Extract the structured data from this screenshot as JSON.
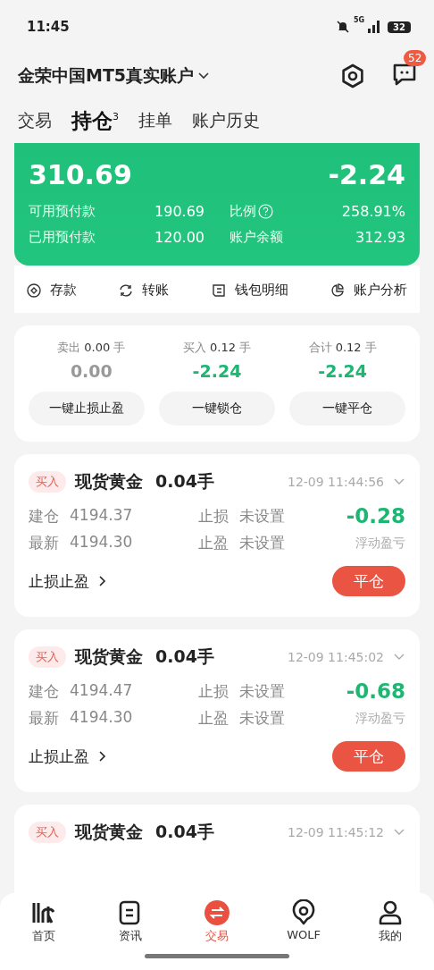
{
  "status_bar": {
    "time": "11:45",
    "network": "5G",
    "battery": "32"
  },
  "header": {
    "account": "金荣中国MT5真实账户",
    "badge": "52"
  },
  "tabs": [
    {
      "label": "交易",
      "selected": false
    },
    {
      "label": "持仓",
      "selected": true,
      "sup": "3"
    },
    {
      "label": "挂单",
      "selected": false
    },
    {
      "label": "账户历史",
      "selected": false
    }
  ],
  "equity": {
    "value": "310.69",
    "pnl": "-2.24",
    "stats": [
      {
        "label": "可用预付款",
        "value": "190.69"
      },
      {
        "label": "比例",
        "value": "258.91%",
        "help": true
      },
      {
        "label": "已用预付款",
        "value": "120.00"
      },
      {
        "label": "账户余额",
        "value": "312.93"
      }
    ]
  },
  "actions": [
    {
      "label": "存款",
      "kind": "deposit"
    },
    {
      "label": "转账",
      "kind": "transfer"
    },
    {
      "label": "钱包明细",
      "kind": "wallet"
    },
    {
      "label": "账户分析",
      "kind": "analysis"
    }
  ],
  "summary": {
    "columns": [
      {
        "label": "卖出",
        "lots": "0.00",
        "unit": "手",
        "pnl": "0.00",
        "loss": false
      },
      {
        "label": "买入",
        "lots": "0.12",
        "unit": "手",
        "pnl": "-2.24",
        "loss": true
      },
      {
        "label": "合计",
        "lots": "0.12",
        "unit": "手",
        "pnl": "-2.24",
        "loss": true
      }
    ],
    "buttons": [
      "一键止损止盈",
      "一键锁仓",
      "一键平仓"
    ]
  },
  "positions": [
    {
      "side": "买入",
      "symbol": "现货黄金",
      "lots": "0.04手",
      "time": "12-09 11:44:56",
      "open_label": "建仓",
      "open": "4194.37",
      "last_label": "最新",
      "last": "4194.30",
      "sl_label": "止损",
      "sl": "未设置",
      "tp_label": "止盈",
      "tp": "未设置",
      "pnl": "-0.28",
      "pnl_label": "浮动盈亏",
      "sltp_link": "止损止盈",
      "close": "平仓"
    },
    {
      "side": "买入",
      "symbol": "现货黄金",
      "lots": "0.04手",
      "time": "12-09 11:45:02",
      "open_label": "建仓",
      "open": "4194.47",
      "last_label": "最新",
      "last": "4194.30",
      "sl_label": "止损",
      "sl": "未设置",
      "tp_label": "止盈",
      "tp": "未设置",
      "pnl": "-0.68",
      "pnl_label": "浮动盈亏",
      "sltp_link": "止损止盈",
      "close": "平仓"
    },
    {
      "side": "买入",
      "symbol": "现货黄金",
      "lots": "0.04手",
      "time": "12-09 11:45:12"
    }
  ],
  "nav": [
    {
      "label": "首页",
      "kind": "home",
      "selected": false
    },
    {
      "label": "资讯",
      "kind": "news",
      "selected": false
    },
    {
      "label": "交易",
      "kind": "trade",
      "selected": true
    },
    {
      "label": "WOLF",
      "kind": "wolf",
      "selected": false
    },
    {
      "label": "我的",
      "kind": "me",
      "selected": false
    }
  ]
}
